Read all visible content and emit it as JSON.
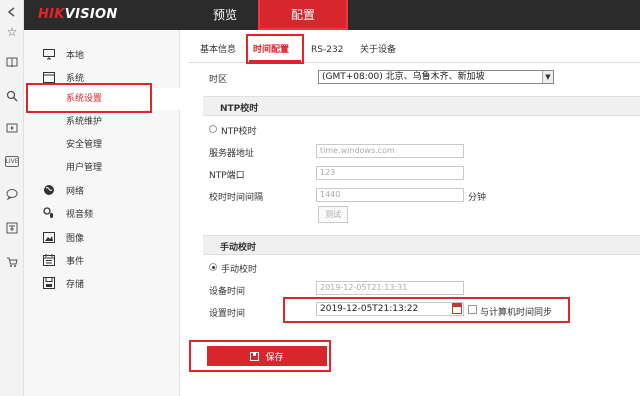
{
  "logo": {
    "part1": "HIK",
    "part2": "VISION"
  },
  "topnav": {
    "preview": "预览",
    "config": "配置"
  },
  "sidebar": {
    "local": "本地",
    "system": "系统",
    "system_settings": "系统设置",
    "system_maintenance": "系统维护",
    "security": "安全管理",
    "users": "用户管理",
    "network": "网络",
    "video_audio": "视音频",
    "image": "图像",
    "event": "事件",
    "storage": "存储"
  },
  "tabs": {
    "basic": "基本信息",
    "time": "时间配置",
    "rs232": "RS-232",
    "about": "关于设备"
  },
  "timezone": {
    "label": "时区",
    "value": "(GMT+08:00) 北京、乌鲁木齐、新加坡"
  },
  "ntp": {
    "section": "NTP校时",
    "radio_label": "NTP校时",
    "server_label": "服务器地址",
    "server_value": "time.windows.com",
    "port_label": "NTP端口",
    "port_value": "123",
    "interval_label": "校时时间间隔",
    "interval_value": "1440",
    "interval_unit": "分钟",
    "test_button": "测试"
  },
  "manual": {
    "section": "手动校时",
    "radio_label": "手动校时",
    "device_time_label": "设备时间",
    "device_time_value": "2019-12-05T21:13:31",
    "set_time_label": "设置时间",
    "set_time_value": "2019-12-05T21:13:22",
    "sync_label": "与计算机时间同步"
  },
  "save_button": "保存",
  "colors": {
    "brand_red": "#d7262c",
    "header": "#2b2b2b",
    "highlight_box": "#e0252b"
  }
}
